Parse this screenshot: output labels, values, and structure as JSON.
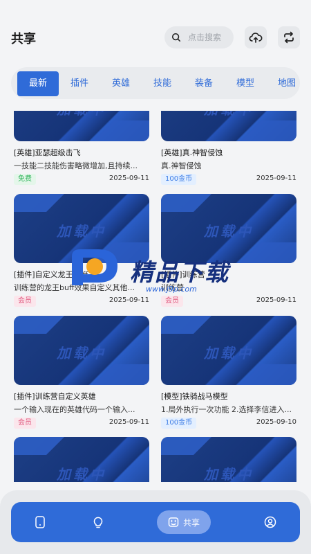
{
  "header": {
    "title": "共享",
    "search_placeholder": "点击搜索",
    "upload_icon": "cloud-upload-icon",
    "refresh_icon": "refresh-icon"
  },
  "tabs": [
    {
      "label": "最新",
      "active": true
    },
    {
      "label": "插件",
      "active": false
    },
    {
      "label": "英雄",
      "active": false
    },
    {
      "label": "技能",
      "active": false
    },
    {
      "label": "装备",
      "active": false
    },
    {
      "label": "模型",
      "active": false
    },
    {
      "label": "地图",
      "active": false
    }
  ],
  "thumb_placeholder": "加载中",
  "cards": [
    {
      "title": "[英雄]亚瑟超级击飞",
      "desc": "一技能二技能伤害略微增加,且持续...",
      "badge": "免费",
      "badge_type": "free",
      "date": "2025-09-11"
    },
    {
      "title": "[英雄]真.神智侵蚀",
      "desc": "真.神智侵蚀",
      "badge": "100金币",
      "badge_type": "gold",
      "date": "2025-09-11"
    },
    {
      "title": "[插件]自定义龙王buff",
      "desc": "训练营的龙王buff效果自定义其他...",
      "badge": "会员",
      "badge_type": "vip",
      "date": "2025-09-11"
    },
    {
      "title": "[插件]训练营",
      "desc": "训练营",
      "badge": "会员",
      "badge_type": "vip",
      "date": "2025-09-11"
    },
    {
      "title": "[插件]训练营自定义英雄",
      "desc": "一个输入现在的英雄代码一个输入...",
      "badge": "会员",
      "badge_type": "vip",
      "date": "2025-09-11"
    },
    {
      "title": "[模型]铁骑战马模型",
      "desc": "1.局外执行一次功能 2.选择李信进入...",
      "badge": "100金币",
      "badge_type": "gold",
      "date": "2025-09-10"
    },
    {
      "title": "",
      "desc": "",
      "badge": "",
      "badge_type": "",
      "date": ""
    },
    {
      "title": "",
      "desc": "",
      "badge": "",
      "badge_type": "",
      "date": ""
    }
  ],
  "watermark": {
    "text": "精品下载",
    "url": "www.j9p.com"
  },
  "bottom_nav": {
    "items": [
      {
        "icon": "phone-icon"
      },
      {
        "icon": "bulb-icon"
      },
      {
        "icon": "share-icon",
        "label": "共享",
        "active": true
      },
      {
        "icon": "user-icon"
      }
    ]
  },
  "colors": {
    "accent": "#2f6bd8",
    "free": "#2fb35a",
    "vip": "#e0587e",
    "gold": "#3e7de6"
  }
}
